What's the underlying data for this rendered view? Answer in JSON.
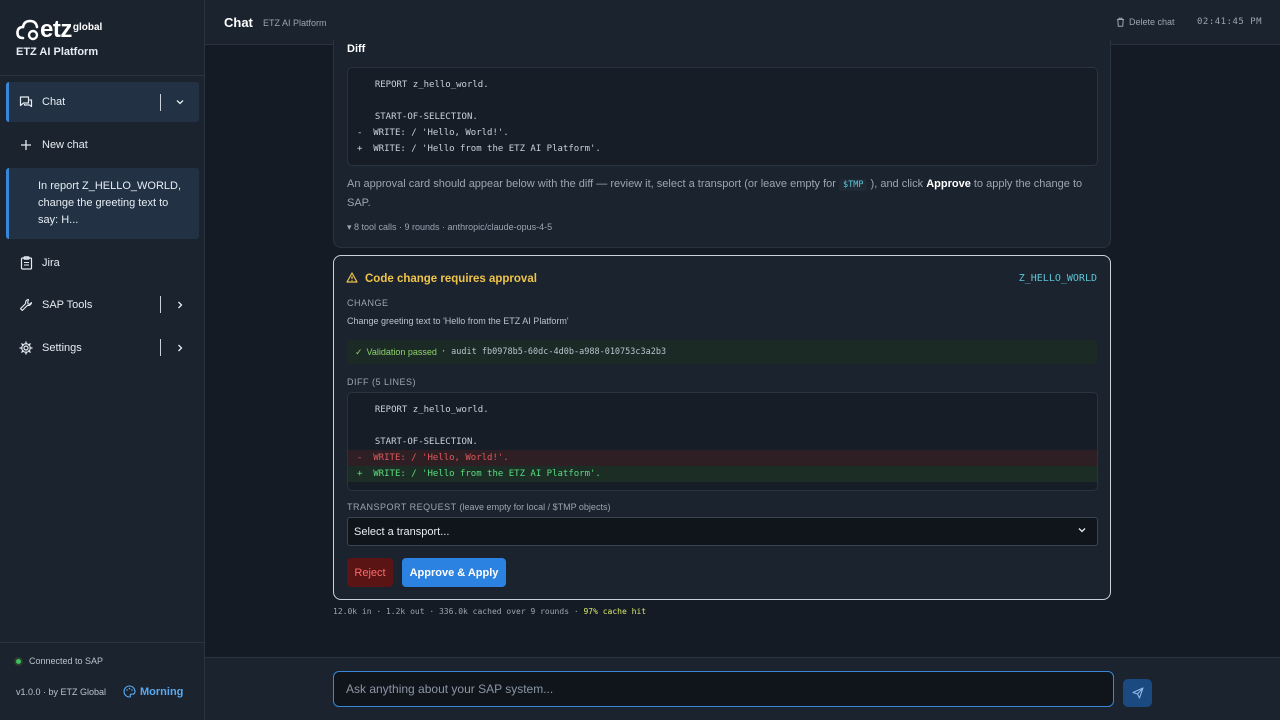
{
  "brand": {
    "logo_text": "etz",
    "logo_suffix": "global",
    "subtitle": "ETZ AI Platform"
  },
  "sidebar": {
    "items": [
      {
        "label": "Chat",
        "icon": "chat-icon"
      },
      {
        "label": "New chat",
        "icon": "plus-icon"
      },
      {
        "label": "Jira",
        "icon": "clipboard-icon"
      },
      {
        "label": "SAP Tools",
        "icon": "wrench-icon"
      },
      {
        "label": "Settings",
        "icon": "gear-icon"
      }
    ],
    "history": [
      {
        "text": "In report Z_HELLO_WORLD, change the greeting text to say: H..."
      }
    ],
    "connection": "Connected to SAP",
    "version": "v1.0.0 · by ETZ Global",
    "greeting": "Morning"
  },
  "header": {
    "title": "Chat",
    "subtitle": "ETZ AI Platform",
    "delete_label": "Delete chat",
    "time": "02:41:45 PM"
  },
  "message": {
    "diff_heading": "Diff",
    "diff_lines": [
      {
        "prefix": " ",
        "text": "REPORT z_hello_world."
      },
      {
        "prefix": " ",
        "text": ""
      },
      {
        "prefix": " ",
        "text": "START-OF-SELECTION."
      },
      {
        "prefix": "-",
        "text": "WRITE: / 'Hello, World!'."
      },
      {
        "prefix": "+",
        "text": "WRITE: / 'Hello from the ETZ AI Platform'."
      }
    ],
    "text_before": "An approval card should appear below with the diff — review it, select a transport (or leave empty for",
    "text_code": "$TMP",
    "text_middle": "), and click",
    "text_bold": "Approve",
    "text_after": "to apply the change to SAP.",
    "meta": "▾ 8 tool calls · 9 rounds · anthropic/claude-opus-4-5"
  },
  "approval": {
    "title": "Code change requires approval",
    "object": "Z_HELLO_WORLD",
    "change_label": "CHANGE",
    "change_text": "Change greeting text to 'Hello from the ETZ AI Platform'",
    "validation_text": "Validation passed",
    "audit": "· audit fb0978b5-60dc-4d0b-a988-010753c3a2b3",
    "diff_label": "DIFF (5 LINES)",
    "transport_label": "TRANSPORT REQUEST",
    "transport_hint": "(leave empty for local / $TMP objects)",
    "transport_placeholder": "Select a transport...",
    "reject_label": "Reject",
    "approve_label": "Approve & Apply"
  },
  "usage": {
    "text": "12.0k in · 1.2k out · 336.0k cached over 9 rounds ·",
    "cache_hit": "97% cache hit"
  },
  "composer": {
    "placeholder": "Ask anything about your SAP system..."
  },
  "colors": {
    "accent": "#3a86d8",
    "warning": "#f0c44a",
    "success": "#5bdc7f",
    "danger": "#e0595c"
  }
}
